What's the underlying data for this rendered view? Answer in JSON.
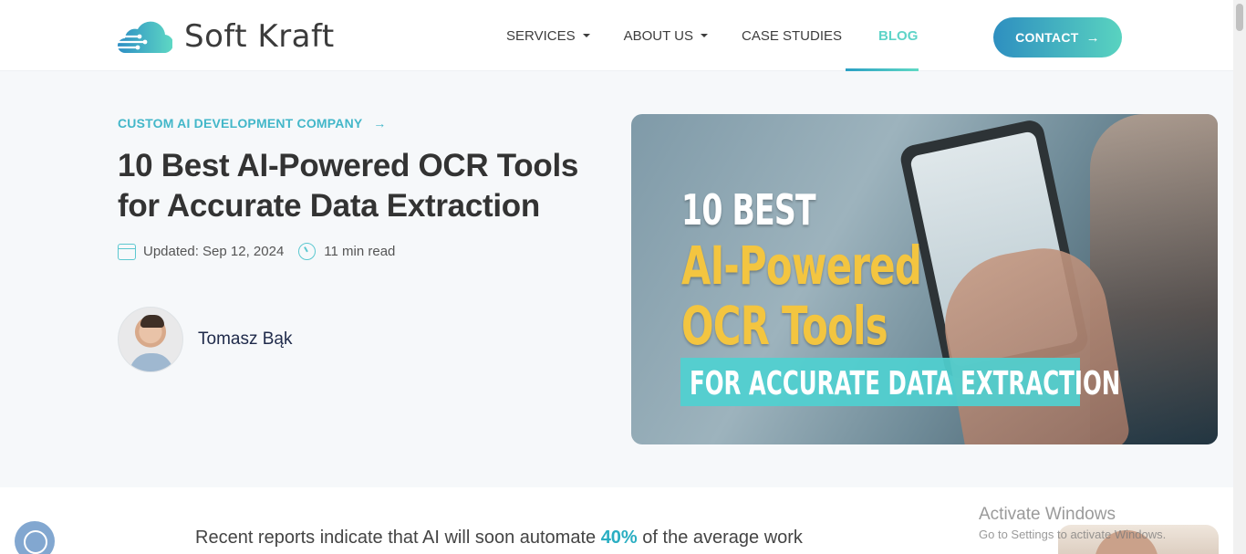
{
  "header": {
    "logo_text": "Soft Kraft",
    "nav": [
      {
        "label": "SERVICES",
        "has_dropdown": true
      },
      {
        "label": "ABOUT US",
        "has_dropdown": true
      },
      {
        "label": "CASE STUDIES",
        "has_dropdown": false
      },
      {
        "label": "BLOG",
        "has_dropdown": false,
        "active": true
      }
    ],
    "contact_label": "CONTACT",
    "contact_arrow": "→"
  },
  "hero": {
    "category": "CUSTOM AI DEVELOPMENT COMPANY",
    "category_arrow": "→",
    "title": "10 Best AI-Powered OCR Tools for Accurate Data Extraction",
    "updated": "Updated: Sep 12, 2024",
    "read_time": "11 min read",
    "author": "Tomasz Bąk"
  },
  "feature_image": {
    "line1": "10 BEST",
    "line2": "AI-Powered",
    "line3": "OCR Tools",
    "line4": "FOR ACCURATE DATA EXTRACTION"
  },
  "article": {
    "intro_before": "Recent reports indicate that AI will soon automate ",
    "intro_highlight": "40%",
    "intro_after": " of the average work"
  },
  "watermark": {
    "title": "Activate Windows",
    "subtitle": "Go to Settings to activate Windows."
  },
  "colors": {
    "accent": "#43b7c9",
    "highlight_yellow": "#f3c540",
    "title": "#333333",
    "hero_bg": "#f6f8fa"
  }
}
